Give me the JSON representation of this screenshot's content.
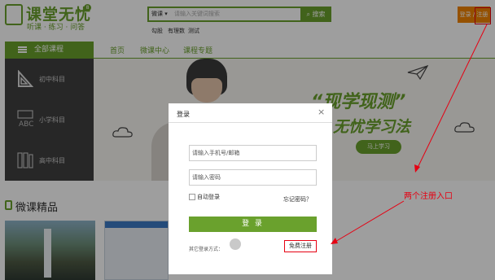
{
  "header": {
    "logo_title": "课堂无忧",
    "logo_sub": "听课 · 练习 · 问答",
    "logo_badge": "8",
    "search": {
      "category": "微课",
      "placeholder": "请输入关键词搜索",
      "button": "搜索"
    },
    "hot_words": [
      "勾股",
      "有理数",
      "测试"
    ],
    "login_register": "登录 / 注册"
  },
  "nav": {
    "all_courses": "全部课程",
    "links": [
      "首页",
      "微课中心",
      "课程专题"
    ]
  },
  "sidebar": {
    "items": [
      {
        "label": "初中科目",
        "icon": "ruler-icon"
      },
      {
        "label": "小学科目",
        "icon": "abc-icon"
      },
      {
        "label": "高中科目",
        "icon": "books-icon"
      }
    ]
  },
  "banner": {
    "slogan1": "“现学现测”",
    "slogan2": "无忧学习法",
    "button": "马上学习"
  },
  "section": {
    "title": "微课精品"
  },
  "modal": {
    "title": "登录",
    "close": "×",
    "phone_placeholder": "请输入手机号/邮箱",
    "password_placeholder": "请输入密码",
    "auto_login": "自动登录",
    "forgot": "忘记密码？",
    "submit": "登 录",
    "other_login": "其它登录方式：",
    "register": "免费注册"
  },
  "annotation": {
    "text": "两个注册入口"
  },
  "colors": {
    "green": "#6aa12d",
    "orange": "#f08300",
    "red": "#e60012"
  }
}
